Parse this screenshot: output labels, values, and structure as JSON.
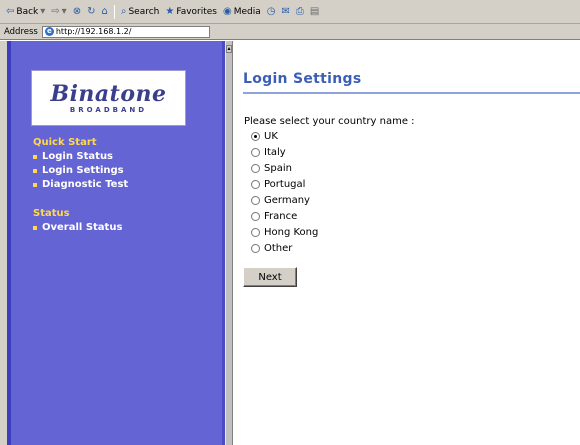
{
  "browser": {
    "toolbar": {
      "back_label": "Back",
      "search_label": "Search",
      "favorites_label": "Favorites",
      "media_label": "Media"
    },
    "address": {
      "label": "Address",
      "url": "http://192.168.1.2/"
    }
  },
  "sidebar": {
    "logo": {
      "name": "Binatone",
      "tagline": "BROADBAND"
    },
    "sections": [
      {
        "title": "Quick Start",
        "items": [
          "Login Status",
          "Login Settings",
          "Diagnostic Test"
        ]
      },
      {
        "title": "Status",
        "items": [
          "Overall Status"
        ]
      }
    ]
  },
  "main": {
    "title": "Login Settings",
    "prompt": "Please select your country name :",
    "countries": [
      "UK",
      "Italy",
      "Spain",
      "Portugal",
      "Germany",
      "France",
      "Hong Kong",
      "Other"
    ],
    "selected_country": "UK",
    "next_label": "Next"
  },
  "colors": {
    "sidebar_bg": "#6464d4",
    "section_title": "#ffd94a",
    "page_title": "#3b5fb5"
  }
}
